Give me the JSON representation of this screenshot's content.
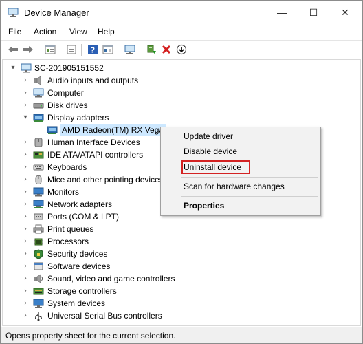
{
  "window": {
    "title": "Device Manager",
    "controls": {
      "minimize": "—",
      "maximize": "☐",
      "close": "✕"
    }
  },
  "menubar": [
    "File",
    "Action",
    "View",
    "Help"
  ],
  "toolbar": [
    "back-icon",
    "forward-icon",
    "properties-sheet-icon",
    "show-hidden-icon",
    "help-icon",
    "action-sheet-icon",
    "scan-hardware-icon",
    "update-driver-icon",
    "uninstall-icon",
    "disable-device-icon"
  ],
  "tree": {
    "root": "SC-201905151552",
    "categories": [
      {
        "label": "Audio inputs and outputs",
        "icon": "speaker-icon",
        "expanded": false
      },
      {
        "label": "Computer",
        "icon": "computer-icon",
        "expanded": false
      },
      {
        "label": "Disk drives",
        "icon": "disk-drive-icon",
        "expanded": false
      },
      {
        "label": "Display adapters",
        "icon": "display-adapter-icon",
        "expanded": true,
        "children": [
          {
            "label": "AMD Radeon(TM) RX Vega",
            "icon": "display-adapter-icon",
            "selected": true
          }
        ]
      },
      {
        "label": "Human Interface Devices",
        "icon": "hid-icon",
        "expanded": false
      },
      {
        "label": "IDE ATA/ATAPI controllers",
        "icon": "ide-controller-icon",
        "expanded": false
      },
      {
        "label": "Keyboards",
        "icon": "keyboard-icon",
        "expanded": false
      },
      {
        "label": "Mice and other pointing devices",
        "icon": "mouse-icon",
        "expanded": false
      },
      {
        "label": "Monitors",
        "icon": "monitor-icon",
        "expanded": false
      },
      {
        "label": "Network adapters",
        "icon": "network-adapter-icon",
        "expanded": false
      },
      {
        "label": "Ports (COM & LPT)",
        "icon": "port-icon",
        "expanded": false
      },
      {
        "label": "Print queues",
        "icon": "printer-icon",
        "expanded": false
      },
      {
        "label": "Processors",
        "icon": "processor-icon",
        "expanded": false
      },
      {
        "label": "Security devices",
        "icon": "security-device-icon",
        "expanded": false
      },
      {
        "label": "Software devices",
        "icon": "software-device-icon",
        "expanded": false
      },
      {
        "label": "Sound, video and game controllers",
        "icon": "sound-controller-icon",
        "expanded": false
      },
      {
        "label": "Storage controllers",
        "icon": "storage-controller-icon",
        "expanded": false
      },
      {
        "label": "System devices",
        "icon": "system-device-icon",
        "expanded": false
      },
      {
        "label": "Universal Serial Bus controllers",
        "icon": "usb-icon",
        "expanded": false
      }
    ]
  },
  "context_menu": {
    "items": [
      "Update driver",
      "Disable device",
      "Uninstall device",
      "Scan for hardware changes",
      "Properties"
    ],
    "highlighted": "Uninstall device",
    "highlight_color": "#d32222"
  },
  "statusbar": {
    "text": "Opens property sheet for the current selection."
  },
  "colors": {
    "selection": "#cde8ff",
    "accent": "#0078d7"
  }
}
